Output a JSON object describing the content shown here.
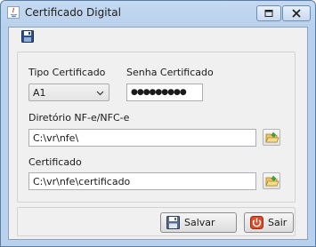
{
  "window": {
    "title": "Certificado Digital"
  },
  "toolbar": {
    "save_icon": "floppy-disk-icon"
  },
  "form": {
    "tipo_label": "Tipo Certificado",
    "tipo_value": "A1",
    "senha_label": "Senha Certificado",
    "senha_value": "●●●●●●●●●",
    "diretorio_label": "Diretório NF-e/NFC-e",
    "diretorio_value": "C:\\vr\\nfe\\",
    "certificado_label": "Certificado",
    "certificado_value": "C:\\vr\\nfe\\certificado"
  },
  "buttons": {
    "salvar_label": "Salvar",
    "sair_label": "Sair"
  },
  "colors": {
    "title_bar": "#c5daf1",
    "client_bg": "#f0f0f0",
    "sair_icon": "#e04a2a"
  }
}
